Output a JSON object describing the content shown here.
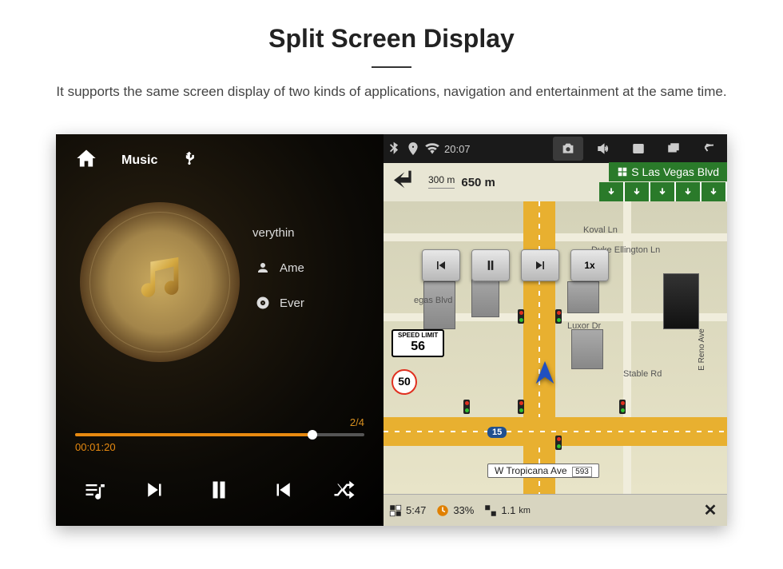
{
  "header": {
    "title": "Split Screen Display",
    "subtitle": "It supports the same screen display of two kinds of applications, navigation and entertainment at the same time."
  },
  "music": {
    "app_label": "Music",
    "track_title": "verythin",
    "artist": "Ame",
    "album": "Ever",
    "track_count": "2/4",
    "elapsed": "00:01:20"
  },
  "status": {
    "time": "20:07"
  },
  "nav": {
    "turn_dist1": "300 m",
    "turn_dist2": "650 m",
    "dest_street": "S Las Vegas Blvd",
    "speed_btn": "1x",
    "streets": {
      "koval": "Koval Ln",
      "duke": "Duke Ellington Ln",
      "vegas": "egas Blvd",
      "luxor": "Luxor Dr",
      "stable": "Stable Rd",
      "reno": "E Reno Ave",
      "tropicana": "W Tropicana Ave",
      "tropicana_num": "593"
    },
    "speed_limit_label": "SPEED LIMIT",
    "speed_limit": "56",
    "speed_current": "50",
    "interstate": "15",
    "bottom": {
      "eta": "5:47",
      "fuel_pct": "33%",
      "dist": "1.1",
      "dist_unit": "km"
    }
  }
}
